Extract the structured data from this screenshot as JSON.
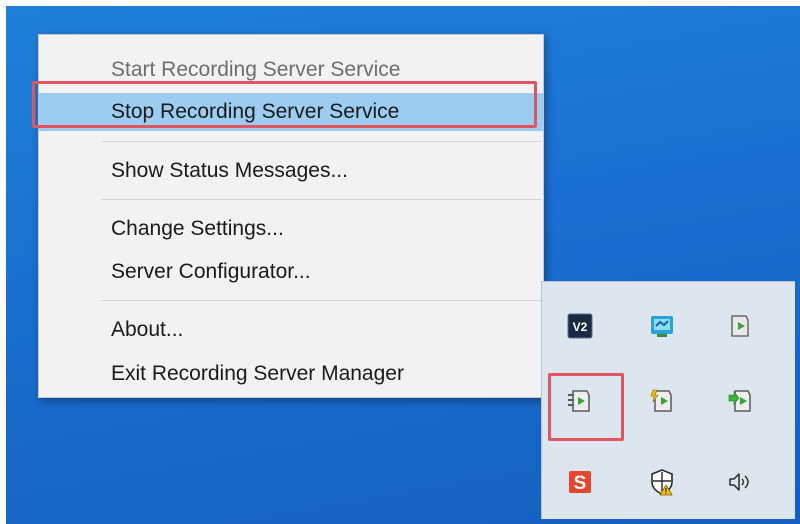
{
  "context_menu": {
    "items": [
      {
        "label": "Start Recording Server Service",
        "state": "disabled"
      },
      {
        "label": "Stop Recording Server Service",
        "state": "highlighted"
      },
      {
        "label": "Show Status Messages...",
        "state": "enabled"
      },
      {
        "label": "Change Settings...",
        "state": "enabled"
      },
      {
        "label": "Server Configurator...",
        "state": "enabled"
      },
      {
        "label": "About...",
        "state": "enabled"
      },
      {
        "label": "Exit Recording Server Manager",
        "state": "enabled"
      }
    ]
  },
  "tray": {
    "icons": [
      {
        "name": "v2-app-icon",
        "label": "V2"
      },
      {
        "name": "network-monitor-icon"
      },
      {
        "name": "management-server-icon"
      },
      {
        "name": "recording-server-manager-icon"
      },
      {
        "name": "event-server-icon"
      },
      {
        "name": "mobile-server-icon"
      },
      {
        "name": "s-app-icon",
        "label": "S"
      },
      {
        "name": "security-shield-warning-icon"
      },
      {
        "name": "speaker-volume-icon"
      }
    ]
  },
  "colors": {
    "desktop": "#1a6fd0",
    "menu_background": "#f2f2f2",
    "menu_highlight": "#9ccdf1",
    "annotation_frame": "#e05560",
    "tray_background": "#dde5ee"
  }
}
